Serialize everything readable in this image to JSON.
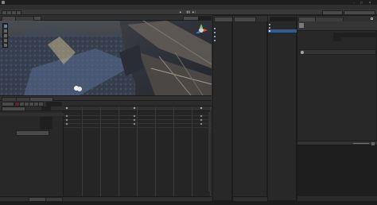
{
  "window": {
    "title": "",
    "controls": {
      "minimize": "–",
      "maximize": "□",
      "close": "✕"
    }
  },
  "menu": {
    "items": [
      "",
      "",
      "",
      "",
      "",
      "",
      "",
      "",
      ""
    ]
  },
  "toolbar": {
    "play": "▶",
    "pause": "❚❚",
    "step": "▶❘",
    "layout_label": ""
  },
  "scene": {
    "tabs": [
      "",
      ""
    ],
    "toggle_2d": "",
    "gizmo_labels": {
      "x": "x",
      "y": "y",
      "z": "z"
    }
  },
  "animation": {
    "tabs": [
      "",
      "",
      ""
    ],
    "preview": "",
    "sample_label": "",
    "properties": [
      {
        "label": "",
        "value": ""
      },
      {
        "label": "",
        "value": ""
      },
      {
        "label": "",
        "value": ""
      },
      {
        "label": "",
        "value": ""
      }
    ],
    "add_property": "",
    "ruler": [
      "",
      "",
      "",
      "",
      "",
      "",
      "",
      ""
    ],
    "bottom_tabs": [
      "",
      ""
    ]
  },
  "hierarchy": {
    "tab": "",
    "create": "",
    "items": [
      {
        "label": ""
      },
      {
        "label": ""
      },
      {
        "label": ""
      },
      {
        "label": ""
      }
    ]
  },
  "project": {
    "tab": "",
    "create": "",
    "tree": [
      "",
      "",
      "",
      "",
      "",
      "",
      "",
      "",
      "",
      "",
      "",
      "",
      "",
      "",
      "",
      ""
    ],
    "packages": "",
    "footer": "",
    "file_items": [
      "",
      "",
      ""
    ]
  },
  "inspector": {
    "tabs": [
      "",
      ""
    ],
    "object_name": "",
    "fields": [
      {
        "label": "",
        "value": ""
      },
      {
        "label": "",
        "value": ""
      },
      {
        "label": "",
        "value": ""
      },
      {
        "label": "",
        "value": ""
      }
    ],
    "note": "",
    "description": ""
  },
  "preview": {
    "title": "",
    "message_line1": "",
    "message_line2": "",
    "footer": ""
  },
  "status": {
    "text": ""
  }
}
